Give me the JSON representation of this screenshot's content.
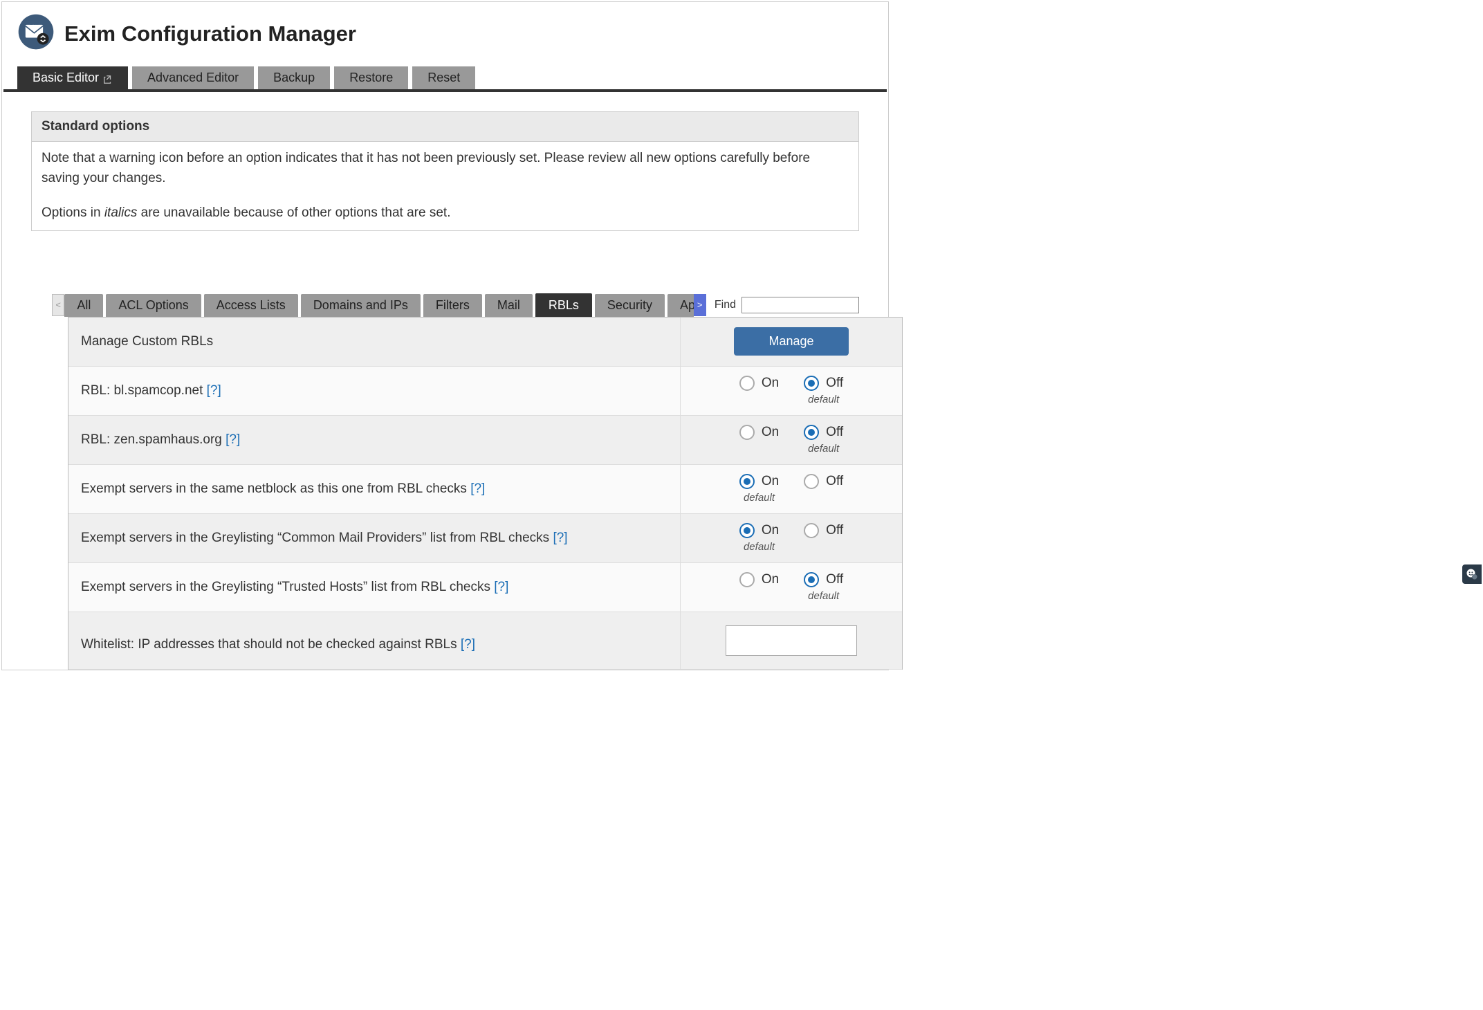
{
  "header": {
    "title": "Exim Configuration Manager"
  },
  "main_tabs": {
    "items": [
      {
        "label": "Basic Editor",
        "active": true
      },
      {
        "label": "Advanced Editor"
      },
      {
        "label": "Backup"
      },
      {
        "label": "Restore"
      },
      {
        "label": "Reset"
      }
    ]
  },
  "standard_options": {
    "heading": "Standard options",
    "note_prefix": "Note that a warning icon before an option indicates that it has not been previously set. Please review all new options carefully before saving your changes.",
    "italic_prefix": "Options in ",
    "italic_word": "italics",
    "italic_suffix": " are unavailable because of other options that are set."
  },
  "sub_tabs": {
    "scroll_left": "<",
    "scroll_right": ">",
    "find_label": "Find",
    "items": [
      {
        "label": "All"
      },
      {
        "label": "ACL Options"
      },
      {
        "label": "Access Lists"
      },
      {
        "label": "Domains and IPs"
      },
      {
        "label": "Filters"
      },
      {
        "label": "Mail"
      },
      {
        "label": "RBLs",
        "active": true
      },
      {
        "label": "Security"
      },
      {
        "label": "Apache SpamAssassin™"
      }
    ]
  },
  "common": {
    "on": "On",
    "off": "Off",
    "default": "default",
    "help": "[?]"
  },
  "settings": [
    {
      "label": "Manage Custom RBLs",
      "control": "manage",
      "manage_label": "Manage"
    },
    {
      "label": "RBL: bl.spamcop.net",
      "help": true,
      "control": "radio",
      "selected": "off",
      "default": "off"
    },
    {
      "label": "RBL: zen.spamhaus.org",
      "help": true,
      "control": "radio",
      "selected": "off",
      "default": "off"
    },
    {
      "label": "Exempt servers in the same netblock as this one from RBL checks",
      "help": true,
      "control": "radio",
      "selected": "on",
      "default": "on"
    },
    {
      "label": "Exempt servers in the Greylisting “Common Mail Providers” list from RBL checks",
      "help": true,
      "control": "radio",
      "selected": "on",
      "default": "on"
    },
    {
      "label": "Exempt servers in the Greylisting “Trusted Hosts” list from RBL checks",
      "help": true,
      "control": "radio",
      "selected": "off",
      "default": "off"
    },
    {
      "label": "Whitelist: IP addresses that should not be checked against RBLs",
      "help": true,
      "control": "textarea"
    }
  ]
}
